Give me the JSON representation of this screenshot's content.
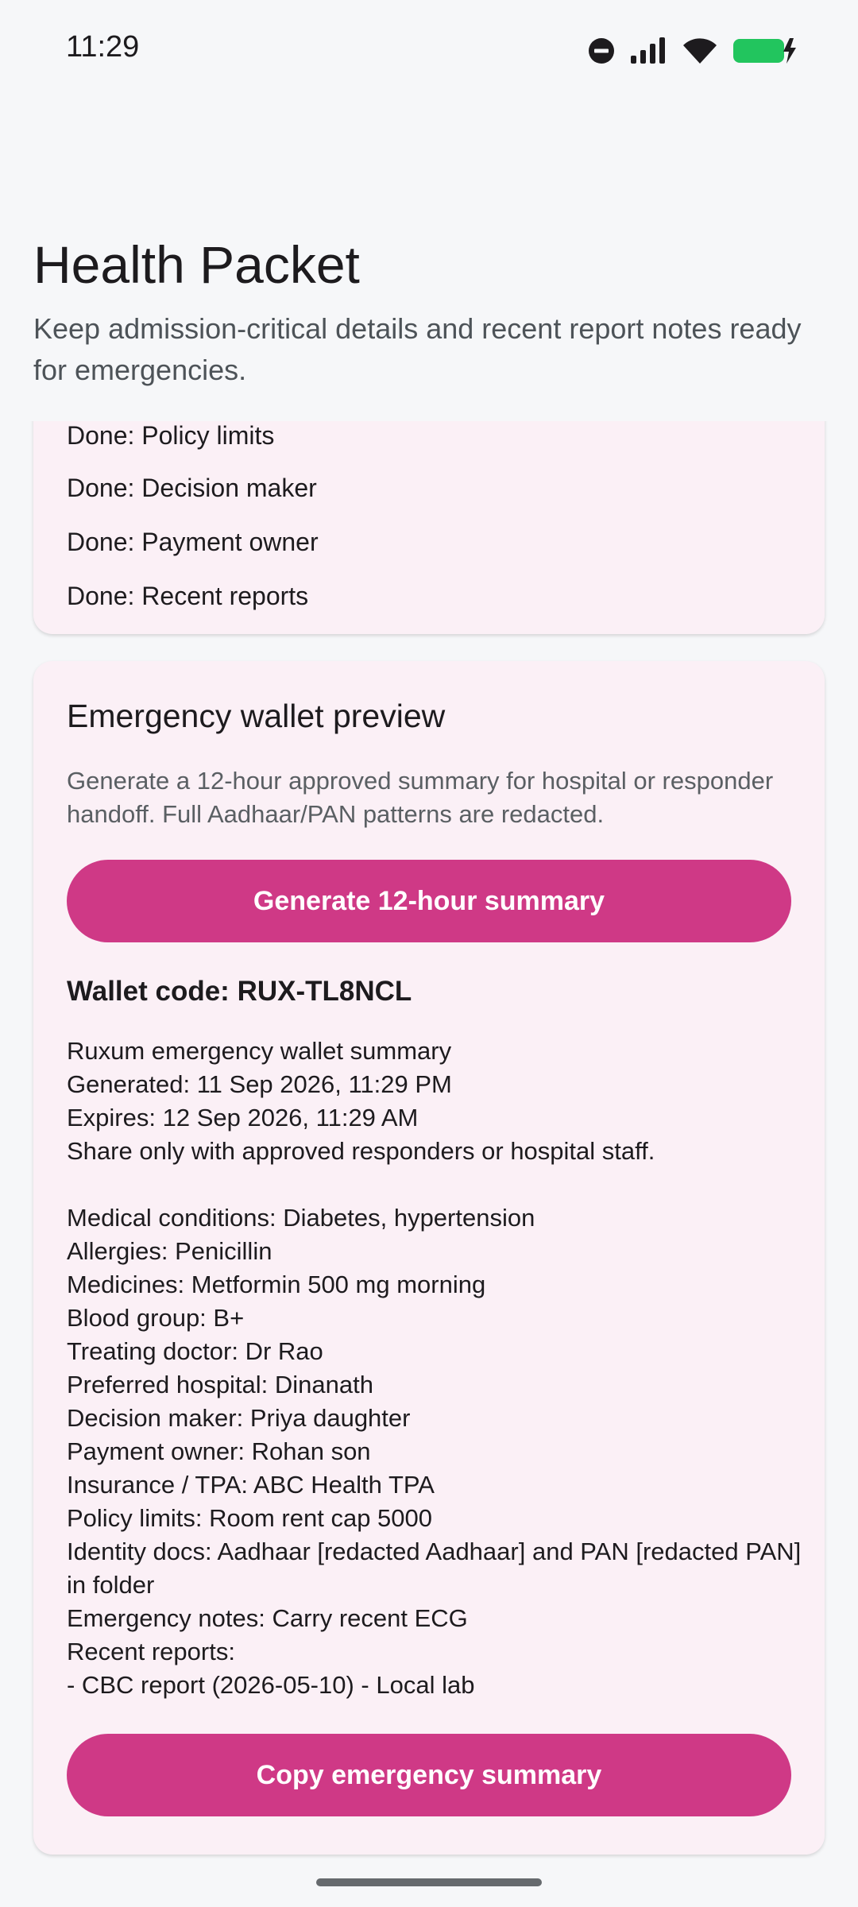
{
  "status_bar": {
    "time": "11:29"
  },
  "header": {
    "title": "Health Packet",
    "subtitle": "Keep admission-critical details and recent report notes ready for emergencies."
  },
  "checklist": {
    "items": [
      "Done: Policy limits",
      "Done: Decision maker",
      "Done: Payment owner",
      "Done: Recent reports"
    ]
  },
  "wallet": {
    "title": "Emergency wallet preview",
    "description": "Generate a 12-hour approved summary for hospital or responder handoff. Full Aadhaar/PAN patterns are redacted.",
    "generate_label": "Generate 12-hour summary",
    "code_label": "Wallet code: RUX-TL8NCL",
    "summary_lines": [
      "Ruxum emergency wallet summary",
      "Generated: 11 Sep 2026, 11:29 PM",
      "Expires: 12 Sep 2026, 11:29 AM",
      "Share only with approved responders or hospital staff.",
      "",
      "Medical conditions: Diabetes, hypertension",
      "Allergies: Penicillin",
      "Medicines: Metformin 500 mg morning",
      "Blood group: B+",
      "Treating doctor: Dr Rao",
      "Preferred hospital: Dinanath",
      "Decision maker: Priya daughter",
      "Payment owner: Rohan son",
      "Insurance / TPA: ABC Health TPA",
      "Policy limits: Room rent cap 5000",
      "Identity docs: Aadhaar [redacted Aadhaar] and PAN [redacted PAN] in folder",
      "Emergency notes: Carry recent ECG",
      "Recent reports:",
      "- CBC report (2026-05-10) - Local lab"
    ],
    "copy_label": "Copy emergency summary"
  },
  "colors": {
    "accent": "#cf3986",
    "card_background": "#fbf0f6",
    "page_background": "#f6f7f9",
    "battery": "#22c55e"
  }
}
